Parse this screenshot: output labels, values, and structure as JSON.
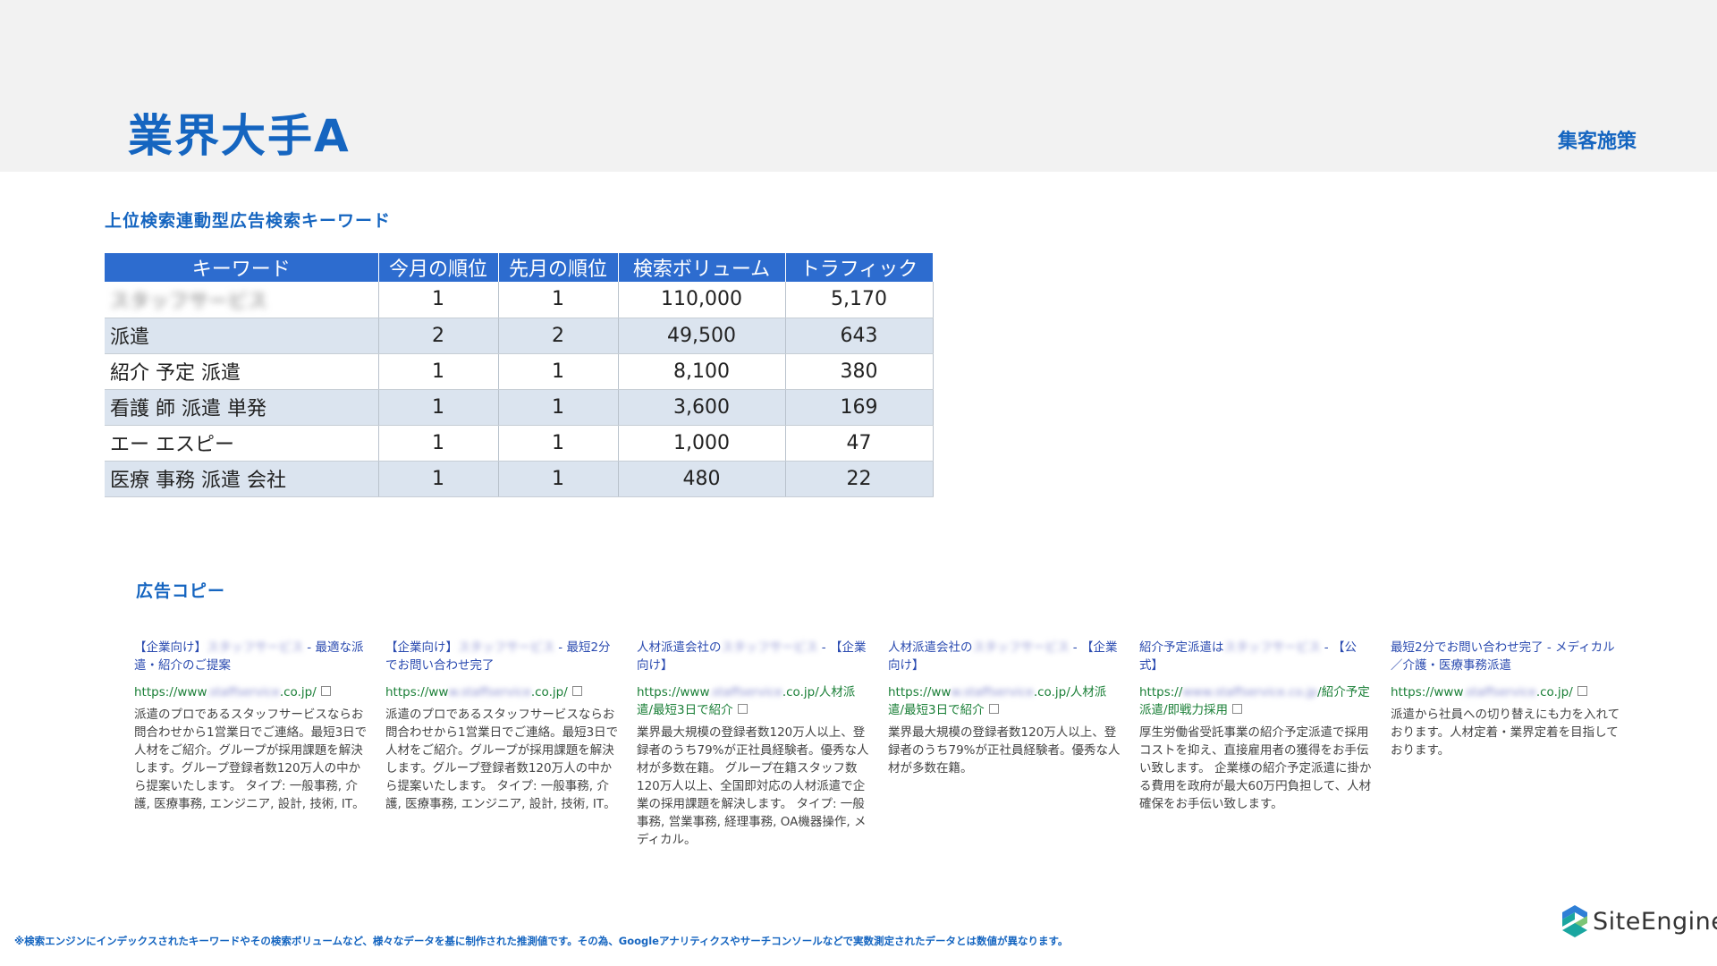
{
  "header": {
    "title": "業界大手A",
    "section": "集客施策"
  },
  "keywords": {
    "heading": "上位検索連動型広告検索キーワード",
    "columns": [
      "キーワード",
      "今月の順位",
      "先月の順位",
      "検索ボリューム",
      "トラフィック"
    ],
    "rows": [
      {
        "keyword": "スタッフサービス",
        "this_rank": "1",
        "prev_rank": "1",
        "volume": "110,000",
        "traffic": "5,170"
      },
      {
        "keyword": "派遣",
        "this_rank": "2",
        "prev_rank": "2",
        "volume": "49,500",
        "traffic": "643"
      },
      {
        "keyword": "紹介 予定 派遣",
        "this_rank": "1",
        "prev_rank": "1",
        "volume": "8,100",
        "traffic": "380"
      },
      {
        "keyword": "看護 師 派遣 単発",
        "this_rank": "1",
        "prev_rank": "1",
        "volume": "3,600",
        "traffic": "169"
      },
      {
        "keyword": "エー エスピー",
        "this_rank": "1",
        "prev_rank": "1",
        "volume": "1,000",
        "traffic": "47"
      },
      {
        "keyword": "医療 事務 派遣 会社",
        "this_rank": "1",
        "prev_rank": "1",
        "volume": "480",
        "traffic": "22"
      }
    ]
  },
  "ads": {
    "heading": "広告コピー",
    "items": [
      {
        "title_a": "【企業向け】",
        "title_b": "スタッフサービス",
        "title_c": " - 最適な派遣・紹介のご提案",
        "url_a": "https://www",
        "url_b": ".staffservice",
        "url_c": ".co.jp/",
        "desc": "派遣のプロであるスタッフサービスならお問合わせから1営業日でご連絡。最短3日で人材をご紹介。グループが採用課題を解決します。グループ登録者数120万人の中から提案いたします。 タイプ: 一般事務, 介護, 医療事務, エンジニア, 設計, 技術, IT。"
      },
      {
        "title_a": "【企業向け】",
        "title_b": "スタッフサービス",
        "title_c": " - 最短2分でお問い合わせ完了",
        "url_a": "https://ww",
        "url_b": "w.staffservice",
        "url_c": ".co.jp/",
        "desc": "派遣のプロであるスタッフサービスならお問合わせから1営業日でご連絡。最短3日で人材をご紹介。グループが採用課題を解決します。グループ登録者数120万人の中から提案いたします。 タイプ: 一般事務, 介護, 医療事務, エンジニア, 設計, 技術, IT。"
      },
      {
        "title_a": "人材派遣会社の",
        "title_b": "スタッフサービス",
        "title_c": " - 【企業向け】",
        "url_a": "https://www",
        "url_b": ".staffservice",
        "url_c": ".co.jp/人材派遣/最短3日で紹介",
        "desc": "業界最大規模の登録者数120万人以上、登録者のうち79%が正社員経験者。優秀な人材が多数在籍。 グループ在籍スタッフ数120万人以上、全国即対応の人材派遣で企業の採用課題を解決します。 タイプ: 一般事務, 営業事務, 経理事務, OA機器操作, メディカル。"
      },
      {
        "title_a": "人材派遣会社の",
        "title_b": "スタッフサービス",
        "title_c": " - 【企業向け】",
        "url_a": "https://ww",
        "url_b": "w.staffservice",
        "url_c": ".co.jp/人材派遣/最短3日で紹介",
        "desc": "業界最大規模の登録者数120万人以上、登録者のうち79%が正社員経験者。優秀な人材が多数在籍。"
      },
      {
        "title_a": "紹介予定派遣は",
        "title_b": "スタッフサービス",
        "title_c": " - 【公式】",
        "url_a": "https://",
        "url_b": "www.staffservice.co.jp",
        "url_c": "/紹介予定派遣/即戦力採用",
        "desc": "厚生労働省受託事業の紹介予定派遣で採用コストを抑え、直接雇用者の獲得をお手伝い致します。 企業様の紹介予定派遣に掛かる費用を政府が最大60万円負担して、人材確保をお手伝い致します。"
      },
      {
        "title_a": "最短2分でお問い合わせ完了 - メディカル／介護・医療事務派遣",
        "title_b": "",
        "title_c": "",
        "url_a": "https://www",
        "url_b": ".staffservice",
        "url_c": ".co.jp/",
        "desc": "派遣から社員への切り替えにも力を入れております。人材定着・業界定着を目指しております。"
      }
    ]
  },
  "footnote": "※検索エンジンにインデックスされたキーワードやその検索ボリュームなど、様々なデータを基に制作された推測値です。その為、Googleアナリティクスやサーチコンソールなどで実数測定されたデータとは数値が異なります。",
  "logo": {
    "text": "SiteEngine",
    "colors": [
      "#1aa6a0",
      "#2f7fd6",
      "#7cc576"
    ]
  }
}
